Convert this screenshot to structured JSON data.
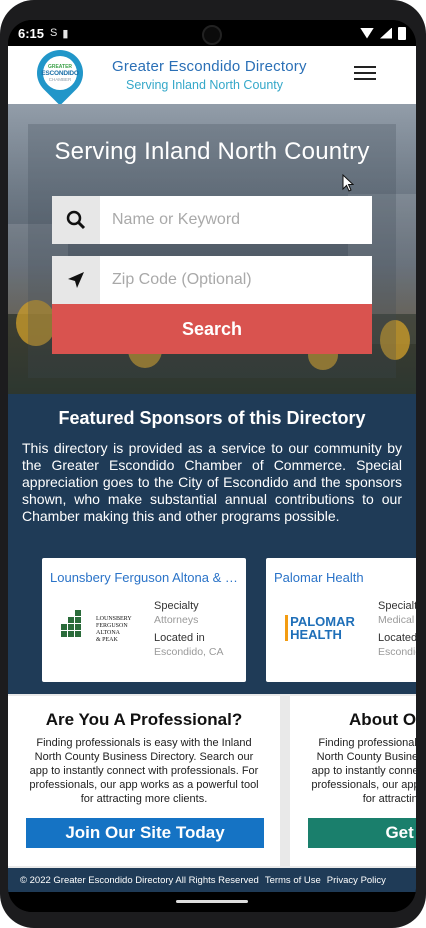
{
  "status_bar": {
    "time": "6:15",
    "icons": [
      "s-icon",
      "sd-card-icon",
      "wifi-icon",
      "signal-icon",
      "battery-icon"
    ]
  },
  "header": {
    "logo_lines": [
      "GREATER",
      "ESCONDIDO",
      "CHAMBER"
    ],
    "title": "Greater  Escondido Directory",
    "subtitle": "Serving Inland North County"
  },
  "hero": {
    "title": "Serving Inland North Country",
    "keyword_placeholder": "Name or Keyword",
    "zip_placeholder": "Zip Code (Optional)",
    "search_label": "Search"
  },
  "sponsors": {
    "title": "Featured Sponsors of this Directory",
    "text": "This directory is provided as a service to our community by the Greater Escondido Chamber of Commerce. Special appreciation goes to the City of Escondido and the sponsors shown, who make substantial annual contributions to our Chamber making this and other programs possible.",
    "cards": [
      {
        "name": "Lounsbery Ferguson Altona & Peak",
        "logo_lines": [
          "LOUNSBERY",
          "FERGUSON",
          "ALTONA",
          "& PEAK"
        ],
        "specialty_label": "Specialty",
        "specialty": "Attorneys",
        "location_label": "Located in",
        "location": "Escondido, CA"
      },
      {
        "name": "Palomar Health",
        "logo_lines": [
          "PALOMAR",
          "HEALTH"
        ],
        "specialty_label": "Specialty",
        "specialty": "Medical",
        "location_label": "Located in",
        "location": "Escondido, CA"
      }
    ]
  },
  "promo": [
    {
      "title": "Are You A Professional?",
      "text": "Finding professionals is easy with the Inland North County Business Directory. Search our app to instantly connect with professionals. For professionals, our app works as a powerful tool for attracting more clients.",
      "button": "Join Our Site Today",
      "button_color": "#1573c4"
    },
    {
      "title": "About Our Listings",
      "text": "Finding professionals is easy with the Inland North County Business Directory. Search our app to instantly connect with professionals. For professionals, our app works as a powerful tool for attracting more clients.",
      "button": "Get Listed",
      "button_color": "#1a7f6c"
    }
  ],
  "footer": {
    "copyright": "© 2022  Greater Escondido Directory  All Rights Reserved",
    "terms": "Terms of Use",
    "privacy": "Privacy Policy"
  }
}
